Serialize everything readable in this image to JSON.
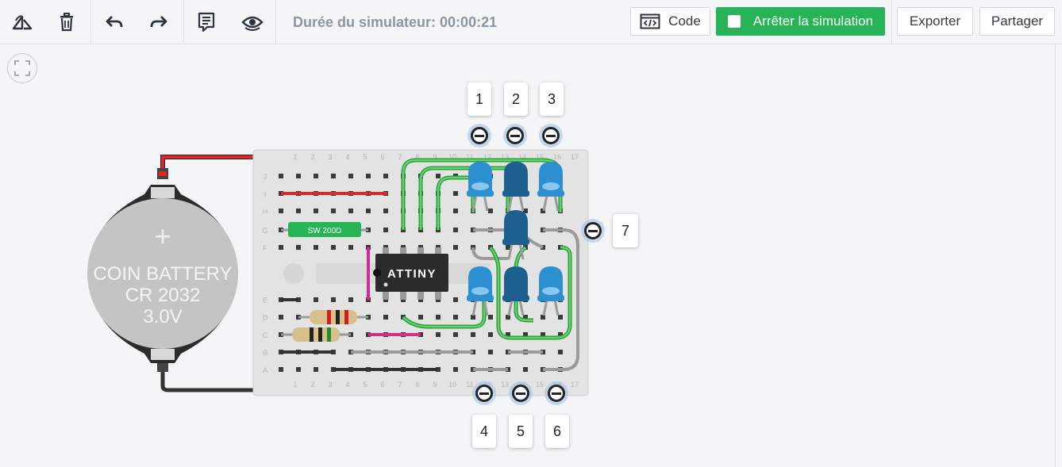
{
  "toolbar": {
    "rotate_icon": "rotate-icon",
    "delete_icon": "trash-icon",
    "undo_icon": "undo-icon",
    "redo_icon": "redo-icon",
    "notes_icon": "notes-icon",
    "visibility_icon": "eye-icon",
    "timer_text": "Durée du simulateur: 00:00:21",
    "code_label": "Code",
    "stop_label": "Arrêter la simulation",
    "export_label": "Exporter",
    "share_label": "Partager",
    "accent_green": "#26b456"
  },
  "circuit": {
    "battery": {
      "line1": "COIN BATTERY",
      "line2": "CR 2032",
      "line3": "3.0V",
      "plus": "+"
    },
    "switch_label": "SW 200D",
    "chip_label": "ATTINY",
    "breadboard_rows": [
      "J",
      "I",
      "H",
      "G",
      "F",
      "E",
      "D",
      "C",
      "B",
      "A"
    ],
    "breadboard_cols": [
      "1",
      "2",
      "3",
      "4",
      "5",
      "6",
      "7",
      "8",
      "9",
      "10",
      "11",
      "12",
      "13",
      "14",
      "15",
      "16",
      "17"
    ],
    "probes": [
      {
        "label": "1"
      },
      {
        "label": "2"
      },
      {
        "label": "3"
      },
      {
        "label": "4"
      },
      {
        "label": "5"
      },
      {
        "label": "6"
      },
      {
        "label": "7"
      }
    ],
    "led_color": "#2e8fd0",
    "led_dark_color": "#1d5f8f"
  }
}
